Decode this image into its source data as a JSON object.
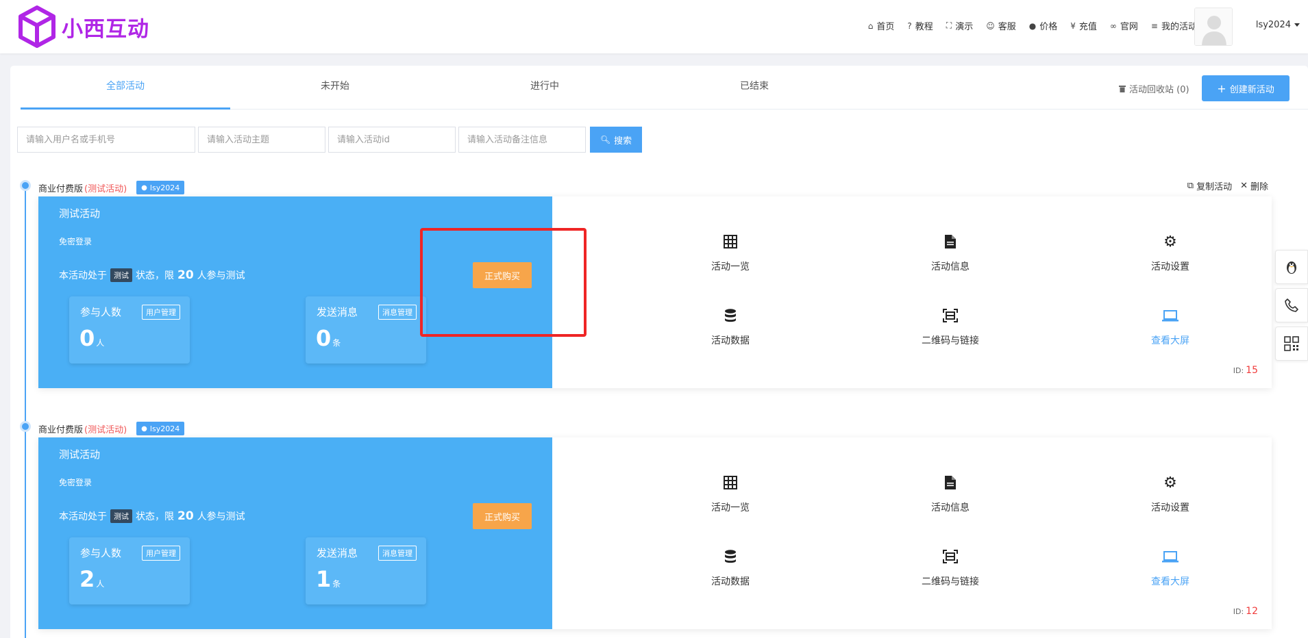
{
  "brand": {
    "name": "小西互动",
    "color": "#b026e6"
  },
  "nav": [
    {
      "label": "首页",
      "icon": "home-icon"
    },
    {
      "label": "教程",
      "icon": "question-icon"
    },
    {
      "label": "演示",
      "icon": "expand-icon"
    },
    {
      "label": "客服",
      "icon": "smile-icon"
    },
    {
      "label": "价格",
      "icon": "info-icon"
    },
    {
      "label": "充值",
      "icon": "yen-icon"
    },
    {
      "label": "官网",
      "icon": "link-icon"
    },
    {
      "label": "我的活动",
      "icon": "list-icon"
    }
  ],
  "user": {
    "name": "lsy2024"
  },
  "tabs": [
    {
      "label": "全部活动",
      "active": true
    },
    {
      "label": "未开始"
    },
    {
      "label": "进行中"
    },
    {
      "label": "已结束"
    }
  ],
  "recycle_label": "活动回收站 (0)",
  "create_label": "创建新活动",
  "filters": {
    "user_placeholder": "请输入用户名或手机号",
    "topic_placeholder": "请输入活动主题",
    "id_placeholder": "请输入活动id",
    "note_placeholder": "请输入活动备注信息",
    "search_label": "搜索"
  },
  "activities": [
    {
      "edition": "商业付费版",
      "tag": "(测试活动)",
      "owner": "lsy2024",
      "copy_label": "复制活动",
      "delete_label": "删除",
      "title": "测试活动",
      "login": "免密登录",
      "status_prefix": "本活动处于",
      "status_badge": "测试",
      "status_mid": "状态，限",
      "limit": "20",
      "status_suffix": "人参与测试",
      "buy_label": "正式购买",
      "participants_label": "参与人数",
      "participants_btn": "用户管理",
      "participants": "0",
      "participants_unit": "人",
      "messages_label": "发送消息",
      "messages_btn": "消息管理",
      "messages": "0",
      "messages_unit": "条",
      "actions": [
        "活动一览",
        "活动信息",
        "活动设置",
        "活动数据",
        "二维码与链接",
        "查看大屏"
      ],
      "id_label": "ID:",
      "id": "15"
    },
    {
      "edition": "商业付费版",
      "tag": "(测试活动)",
      "owner": "lsy2024",
      "title": "测试活动",
      "login": "免密登录",
      "status_prefix": "本活动处于",
      "status_badge": "测试",
      "status_mid": "状态，限",
      "limit": "20",
      "status_suffix": "人参与测试",
      "buy_label": "正式购买",
      "participants_label": "参与人数",
      "participants_btn": "用户管理",
      "participants": "2",
      "participants_unit": "人",
      "messages_label": "发送消息",
      "messages_btn": "消息管理",
      "messages": "1",
      "messages_unit": "条",
      "actions": [
        "活动一览",
        "活动信息",
        "活动设置",
        "活动数据",
        "二维码与链接",
        "查看大屏"
      ],
      "id_label": "ID:",
      "id": "12"
    }
  ],
  "colors": {
    "primary": "#4aa3f5",
    "card": "#4aaff5",
    "buy": "#f7a54a",
    "highlight": "#ef2525"
  }
}
